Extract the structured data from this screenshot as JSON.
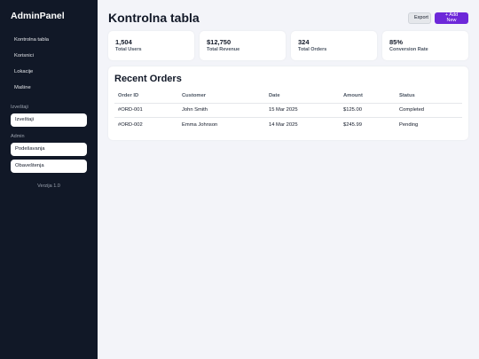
{
  "sidebar": {
    "brand": "AdminPanel",
    "nav": [
      "Kontrolna tabla",
      "Korisnici",
      "Lokacije",
      "Mašine"
    ],
    "reports_label": "Izveštaji",
    "reports_item": "Izveštaji",
    "admin_label": "Admin",
    "admin_items": [
      "Podešavanja",
      "Obaveštenja"
    ],
    "version": "Verzija 1.0"
  },
  "header": {
    "title": "Kontrolna tabla",
    "export_label": "Export",
    "add_label": "+ Add New"
  },
  "stats": [
    {
      "value": "1,504",
      "label": "Total Users"
    },
    {
      "value": "$12,750",
      "label": "Total Revenue"
    },
    {
      "value": "324",
      "label": "Total Orders"
    },
    {
      "value": "85%",
      "label": "Conversion Rate"
    }
  ],
  "orders": {
    "title": "Recent Orders",
    "columns": [
      "Order ID",
      "Customer",
      "Date",
      "Amount",
      "Status"
    ],
    "rows": [
      [
        "#ORD-001",
        "John Smith",
        "15 Mar 2025",
        "$125.00",
        "Completed"
      ],
      [
        "#ORD-002",
        "Emma Johnson",
        "14 Mar 2025",
        "$245.99",
        "Pending"
      ]
    ]
  },
  "colors": {
    "sidebar_bg": "#111827",
    "accent": "#6d28d9",
    "page_bg": "#f3f4f9"
  }
}
